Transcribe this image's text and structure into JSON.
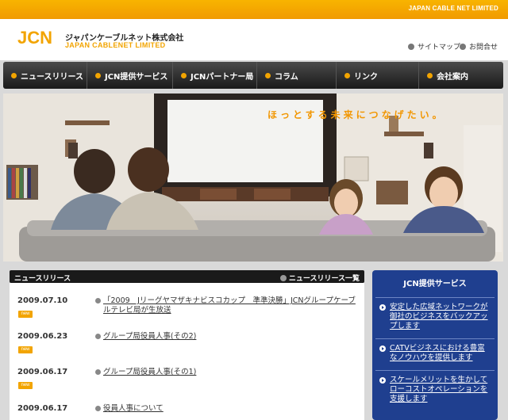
{
  "topbar": {
    "tagline": "JAPAN CABLE NET LIMITED"
  },
  "header": {
    "logo_text": "JCN",
    "company_jp": "ジャパンケーブルネット株式会社",
    "company_en": "JAPAN CABLENET LIMITED",
    "sitemap": "サイトマップ",
    "contact": "お問合せ"
  },
  "nav": {
    "items": [
      {
        "label": "ニュースリリース"
      },
      {
        "label": "JCN提供サービス"
      },
      {
        "label": "JCNパートナー局"
      },
      {
        "label": "コラム"
      },
      {
        "label": "リンク"
      },
      {
        "label": "会社案内"
      }
    ]
  },
  "hero": {
    "copy": "ほっとする未来につなげたい。"
  },
  "news": {
    "title": "ニュースリリース",
    "all_link": "ニュースリリース一覧",
    "badge": "new",
    "items": [
      {
        "date": "2009.07.10",
        "title": "「2009　Jリーグヤマザキナビスコカップ　準準決勝」JCNグループケーブルテレビ局が生放送"
      },
      {
        "date": "2009.06.23",
        "title": "グループ局役員人事(その2)"
      },
      {
        "date": "2009.06.17",
        "title": "グループ局役員人事(その1)"
      },
      {
        "date": "2009.06.17",
        "title": "役員人事について"
      }
    ]
  },
  "services": {
    "title": "JCN提供サービス",
    "items": [
      {
        "label": "安定した広域ネットワークが御社のビジネスをバックアップします"
      },
      {
        "label": "CATVビジネスにおける豊富なノウハウを提供します"
      },
      {
        "label": "スケールメリットを生かしてローコストオペレーションを支援します"
      }
    ]
  },
  "colors": {
    "accent": "#f2a400",
    "navy": "#1f3f8f",
    "dark": "#1a1a1a"
  }
}
